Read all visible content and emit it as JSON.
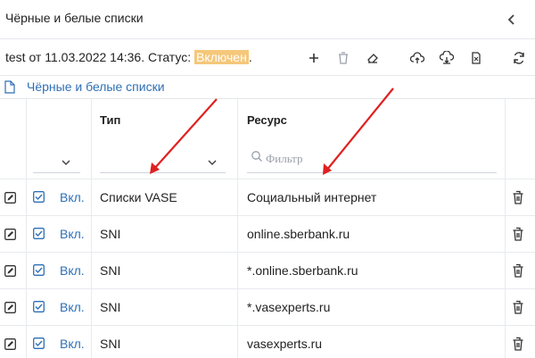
{
  "header": {
    "title": "Чёрные и белые списки"
  },
  "toolbar": {
    "info_prefix": "test от 11.03.2022 14:36. Статус: ",
    "status": "Включен",
    "info_suffix": ".",
    "buttons": [
      "add",
      "delete",
      "clear",
      "upload",
      "download",
      "export",
      "refresh"
    ]
  },
  "breadcrumb": {
    "label": "Чёрные и белые списки"
  },
  "table": {
    "columns": {
      "type": "Тип",
      "resource": "Ресурс"
    },
    "filter_placeholder": "Фильтр",
    "rows": [
      {
        "status": "Вкл.",
        "type": "Списки VASE",
        "resource": "Социальный интернет"
      },
      {
        "status": "Вкл.",
        "type": "SNI",
        "resource": "online.sberbank.ru"
      },
      {
        "status": "Вкл.",
        "type": "SNI",
        "resource": "*.online.sberbank.ru"
      },
      {
        "status": "Вкл.",
        "type": "SNI",
        "resource": "*.vasexperts.ru"
      },
      {
        "status": "Вкл.",
        "type": "SNI",
        "resource": "vasexperts.ru"
      }
    ]
  },
  "colors": {
    "accent": "#2f6fb5",
    "status_badge": "#f5c77a",
    "annotation_arrow": "#e02020"
  }
}
